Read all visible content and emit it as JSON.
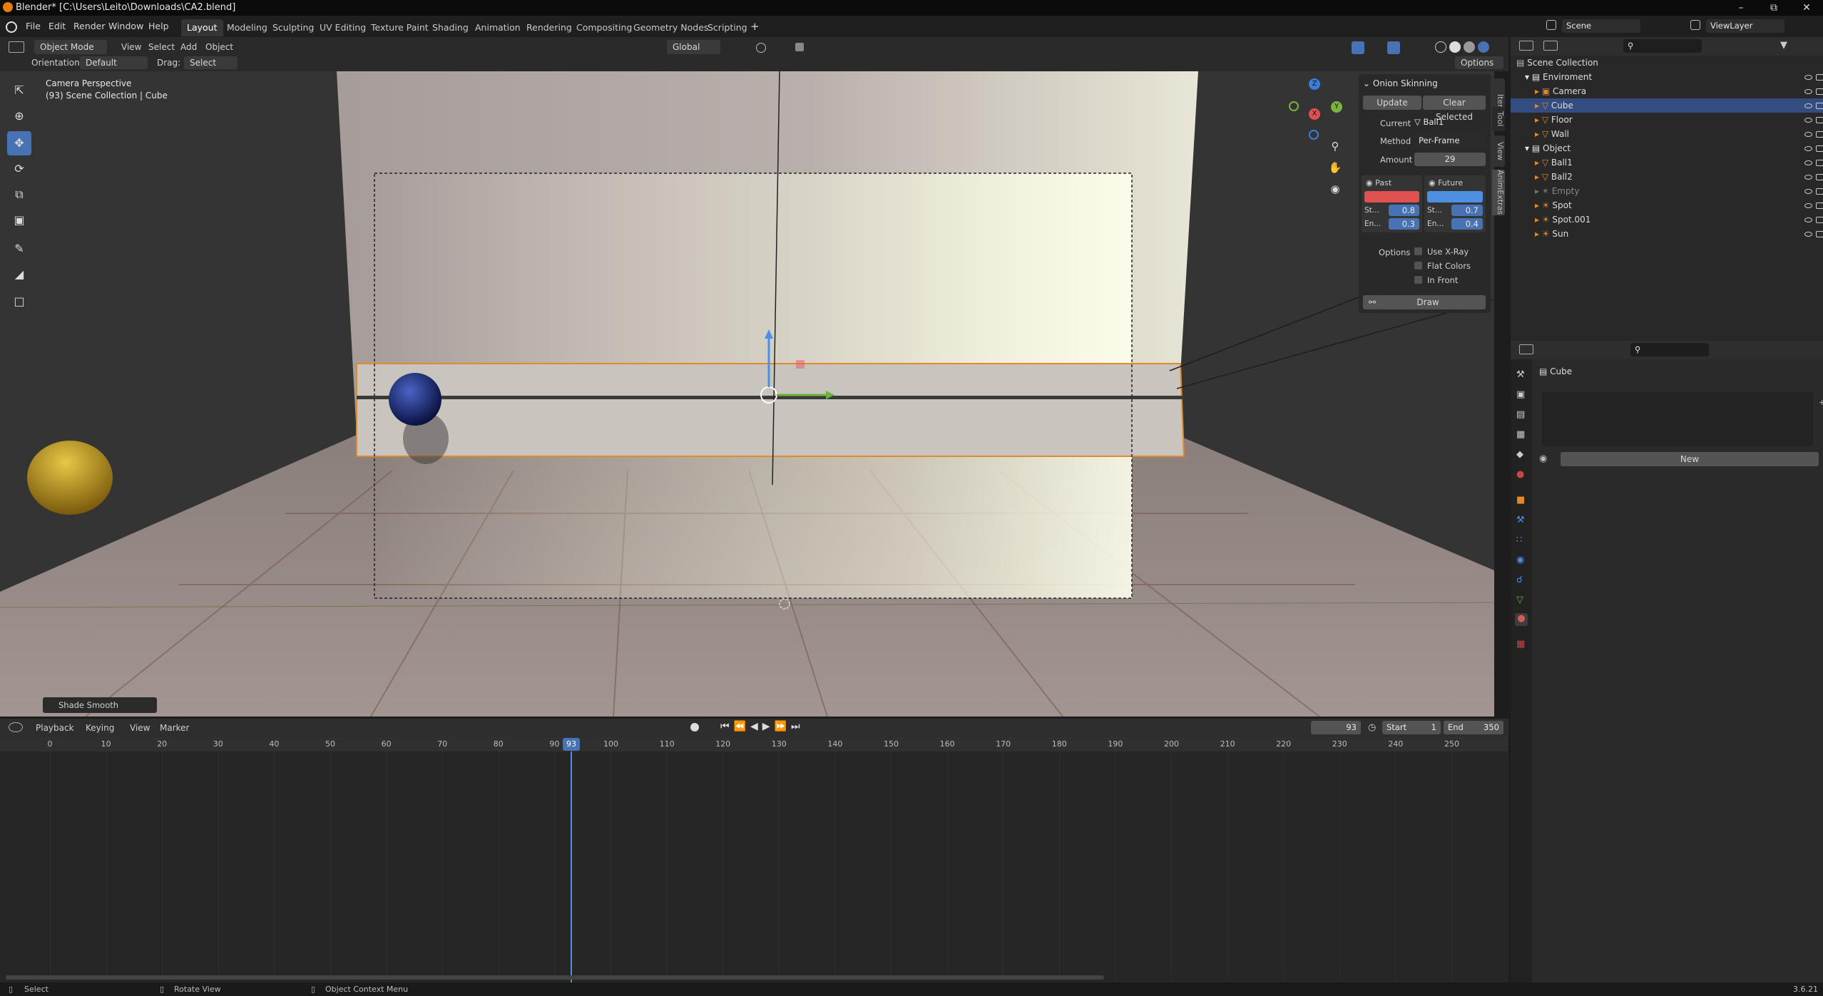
{
  "window": {
    "title": "Blender* [C:\\Users\\Leito\\Downloads\\CA2.blend]",
    "version": "3.6.21"
  },
  "menu": {
    "items": [
      "File",
      "Edit",
      "Render",
      "Window",
      "Help"
    ]
  },
  "workspaces": {
    "tabs": [
      "Layout",
      "Modeling",
      "Sculpting",
      "UV Editing",
      "Texture Paint",
      "Shading",
      "Animation",
      "Rendering",
      "Compositing",
      "Geometry Nodes",
      "Scripting"
    ],
    "active": "Layout",
    "add": "+"
  },
  "scene": {
    "label": "Scene",
    "view_layer": "ViewLayer"
  },
  "viewport_header": {
    "mode": "Object Mode",
    "menus": [
      "View",
      "Select",
      "Add",
      "Object"
    ],
    "transform": "Global",
    "orientation_label": "Orientation:",
    "orientation_value": "Default",
    "drag_label": "Drag:",
    "drag_value": "Select Box",
    "options": "Options"
  },
  "viewport": {
    "camera_text": "Camera Perspective",
    "collection_text": "(93) Scene Collection | Cube",
    "last_op": "Shade Smooth",
    "gizmo": {
      "x": "X",
      "y": "Y",
      "z": "Z"
    }
  },
  "sidebar_tabs": [
    "Item",
    "Tool",
    "View",
    "AnimExtras"
  ],
  "onion": {
    "title": "Onion Skinning",
    "update": "Update",
    "clear": "Clear Selected",
    "current_label": "Current",
    "current_value": "Ball1",
    "method_label": "Method",
    "method_value": "Per-Frame",
    "amount_label": "Amount",
    "amount_value": "29",
    "past": "Past",
    "future": "Future",
    "past_color": "#e05252",
    "future_color": "#4d8fe0",
    "past_start_label": "St...",
    "past_start": "0.8",
    "past_end_label": "En...",
    "past_end": "0.3",
    "future_start_label": "St...",
    "future_start": "0.7",
    "future_end_label": "En...",
    "future_end": "0.4",
    "options_label": "Options",
    "use_xray": "Use X-Ray",
    "flat_colors": "Flat Colors",
    "in_front": "In Front",
    "draw": "Draw"
  },
  "outliner": {
    "root": "Scene Collection",
    "rows": [
      {
        "name": "Enviroment",
        "type": "collection",
        "level": 1
      },
      {
        "name": "Camera",
        "type": "camera",
        "level": 2
      },
      {
        "name": "Cube",
        "type": "mesh",
        "level": 2,
        "selected": true
      },
      {
        "name": "Floor",
        "type": "mesh",
        "level": 2
      },
      {
        "name": "Wall",
        "type": "mesh",
        "level": 2
      },
      {
        "name": "Object",
        "type": "collection",
        "level": 1
      },
      {
        "name": "Ball1",
        "type": "mesh",
        "level": 2
      },
      {
        "name": "Ball2",
        "type": "mesh",
        "level": 2
      },
      {
        "name": "Empty",
        "type": "empty",
        "level": 2,
        "dim": true
      },
      {
        "name": "Spot",
        "type": "light",
        "level": 2
      },
      {
        "name": "Spot.001",
        "type": "light",
        "level": 2
      },
      {
        "name": "Sun",
        "type": "light",
        "level": 2
      }
    ]
  },
  "properties": {
    "object": "Cube",
    "new": "New"
  },
  "timeline": {
    "menus": [
      "Playback",
      "Keying",
      "View",
      "Marker"
    ],
    "current_frame": "93",
    "start_label": "Start",
    "start": "1",
    "end_label": "End",
    "end": "350",
    "ticks": [
      "0",
      "10",
      "20",
      "30",
      "40",
      "50",
      "60",
      "70",
      "80",
      "90",
      "100",
      "110",
      "120",
      "130",
      "140",
      "150",
      "160",
      "170",
      "180",
      "190",
      "200",
      "210",
      "220",
      "230",
      "240",
      "250"
    ]
  },
  "status": {
    "select": "Select",
    "rotate": "Rotate View",
    "context": "Object Context Menu"
  }
}
